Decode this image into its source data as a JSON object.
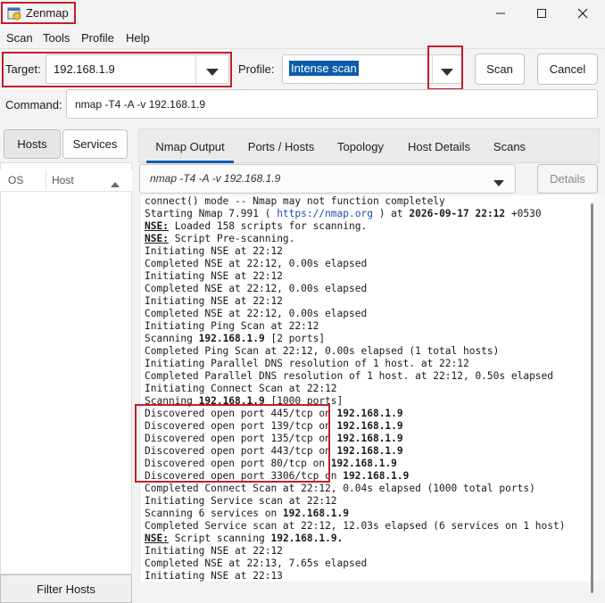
{
  "window": {
    "title": "Zenmap"
  },
  "menu": [
    "Scan",
    "Tools",
    "Profile",
    "Help"
  ],
  "toolbar": {
    "target_label": "Target:",
    "target_value": "192.168.1.9",
    "profile_label": "Profile:",
    "profile_value": "Intense scan",
    "scan_button": "Scan",
    "cancel_button": "Cancel",
    "command_label": "Command:",
    "command_value": "nmap -T4 -A -v 192.168.1.9"
  },
  "left": {
    "hosts_tab": "Hosts",
    "services_tab": "Services",
    "col_os": "OS",
    "col_host": "Host",
    "filter_button": "Filter Hosts"
  },
  "tabs": [
    "Nmap Output",
    "Ports / Hosts",
    "Topology",
    "Host Details",
    "Scans"
  ],
  "output_header": {
    "command": "nmap -T4 -A -v 192.168.1.9",
    "details_button": "Details"
  },
  "output_lines": [
    [
      {
        "t": "connect() mode -- Nmap may not function completely"
      }
    ],
    [
      {
        "t": "Starting Nmap 7.991 ( "
      },
      {
        "t": "https://nmap.org",
        "s": "url"
      },
      {
        "t": " ) at "
      },
      {
        "t": "2026-09-17 22:12",
        "s": "b"
      },
      {
        "t": " +0530"
      }
    ],
    [
      {
        "t": "NSE:",
        "s": "u"
      },
      {
        "t": " Loaded 158 scripts for scanning."
      }
    ],
    [
      {
        "t": "NSE:",
        "s": "u"
      },
      {
        "t": " Script Pre-scanning."
      }
    ],
    [
      {
        "t": "Initiating NSE at 22:12"
      }
    ],
    [
      {
        "t": "Completed NSE at 22:12, 0.00s elapsed"
      }
    ],
    [
      {
        "t": "Initiating NSE at 22:12"
      }
    ],
    [
      {
        "t": "Completed NSE at 22:12, 0.00s elapsed"
      }
    ],
    [
      {
        "t": "Initiating NSE at 22:12"
      }
    ],
    [
      {
        "t": "Completed NSE at 22:12, 0.00s elapsed"
      }
    ],
    [
      {
        "t": "Initiating Ping Scan at 22:12"
      }
    ],
    [
      {
        "t": "Scanning "
      },
      {
        "t": "192.168.1.9",
        "s": "b"
      },
      {
        "t": " [2 ports]"
      }
    ],
    [
      {
        "t": "Completed Ping Scan at 22:12, 0.00s elapsed (1 total hosts)"
      }
    ],
    [
      {
        "t": "Initiating Parallel DNS resolution of 1 host. at 22:12"
      }
    ],
    [
      {
        "t": "Completed Parallel DNS resolution of 1 host. at 22:12, 0.50s elapsed"
      }
    ],
    [
      {
        "t": "Initiating Connect Scan at 22:12"
      }
    ],
    [
      {
        "t": "Scanning "
      },
      {
        "t": "192.168.1.9",
        "s": "b"
      },
      {
        "t": " [1000 ports]"
      }
    ],
    [
      {
        "t": "Discovered open port 445/tcp on "
      },
      {
        "t": "192.168.1.9",
        "s": "b"
      }
    ],
    [
      {
        "t": "Discovered open port 139/tcp on "
      },
      {
        "t": "192.168.1.9",
        "s": "b"
      }
    ],
    [
      {
        "t": "Discovered open port 135/tcp on "
      },
      {
        "t": "192.168.1.9",
        "s": "b"
      }
    ],
    [
      {
        "t": "Discovered open port 443/tcp on "
      },
      {
        "t": "192.168.1.9",
        "s": "b"
      }
    ],
    [
      {
        "t": "Discovered open port 80/tcp on "
      },
      {
        "t": "192.168.1.9",
        "s": "b"
      }
    ],
    [
      {
        "t": "Discovered open port 3306/tcp on "
      },
      {
        "t": "192.168.1.9",
        "s": "b"
      }
    ],
    [
      {
        "t": "Completed Connect Scan at 22:12, 0.04s elapsed (1000 total ports)"
      }
    ],
    [
      {
        "t": "Initiating Service scan at 22:12"
      }
    ],
    [
      {
        "t": "Scanning 6 services on "
      },
      {
        "t": "192.168.1.9",
        "s": "b"
      }
    ],
    [
      {
        "t": "Completed Service scan at 22:12, 12.03s elapsed (6 services on 1 host)"
      }
    ],
    [
      {
        "t": "NSE:",
        "s": "u"
      },
      {
        "t": " Script scanning "
      },
      {
        "t": "192.168.1.9.",
        "s": "b"
      }
    ],
    [
      {
        "t": "Initiating NSE at 22:12"
      }
    ],
    [
      {
        "t": "Completed NSE at 22:13, 7.65s elapsed"
      }
    ],
    [
      {
        "t": "Initiating NSE at 22:13"
      }
    ]
  ],
  "colors": {
    "annotation": "#c0202a",
    "accent": "#0b5cad",
    "selection": "#0b5cad"
  }
}
